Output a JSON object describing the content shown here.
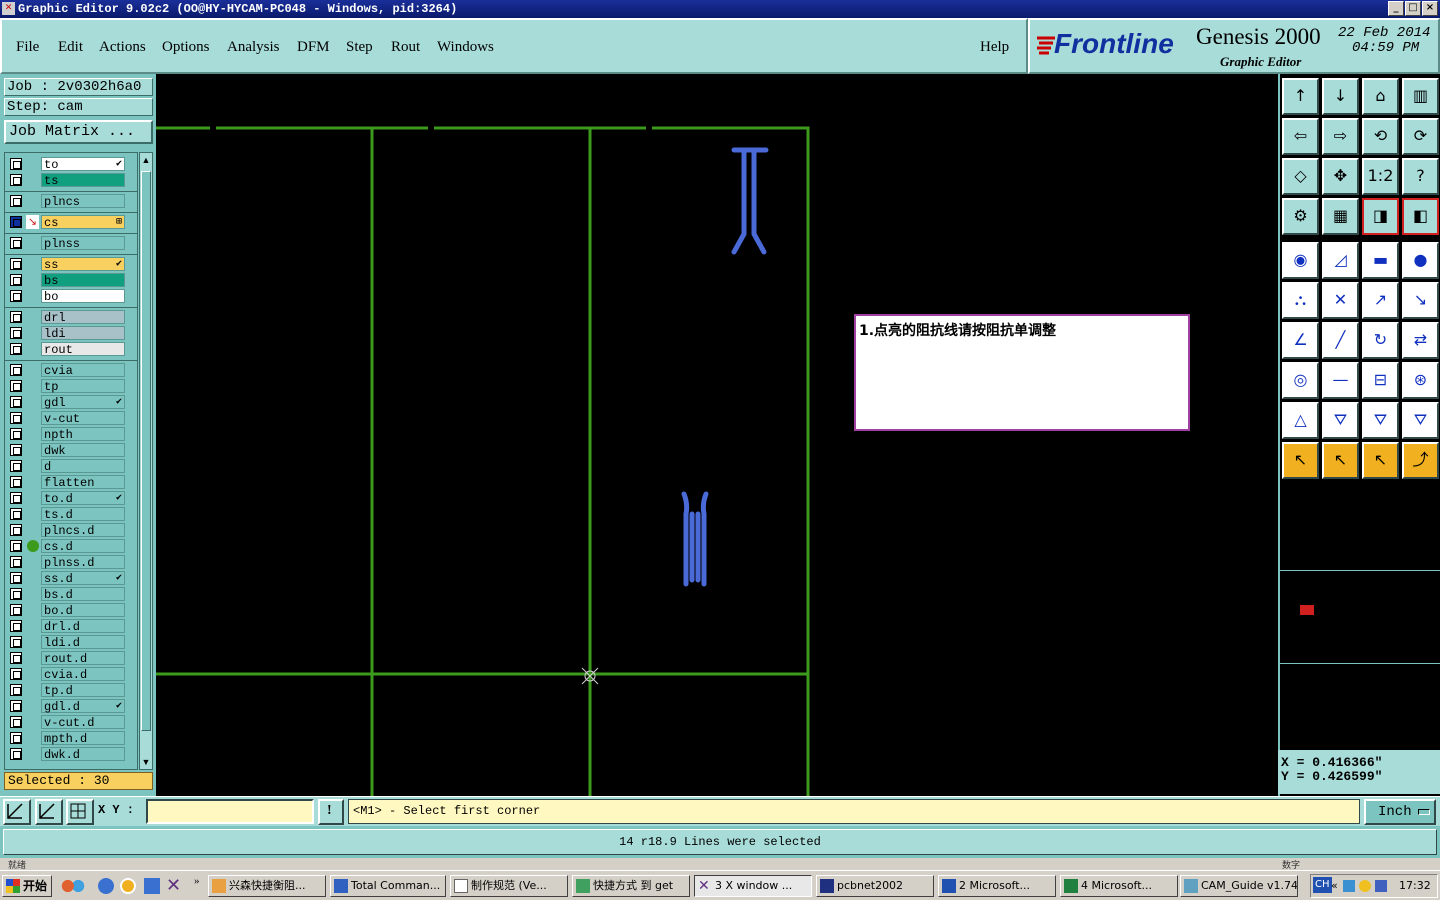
{
  "window": {
    "title": "Graphic Editor 9.02c2 (OO@HY-HYCAM-PC048 - Windows, pid:3264)"
  },
  "menu": {
    "items": [
      "File",
      "Edit",
      "Actions",
      "Options",
      "Analysis",
      "DFM",
      "Step",
      "Rout",
      "Windows"
    ],
    "help": "Help"
  },
  "brand": {
    "logo": "Frontline",
    "product": "Genesis 2000",
    "subtitle": "Graphic Editor",
    "date": "22 Feb 2014",
    "time": "04:59 PM"
  },
  "left": {
    "job": "Job : 2v0302h6a0",
    "step": "Step: cam",
    "job_matrix": "Job Matrix ...",
    "selected": "Selected : 30",
    "layers": [
      {
        "name": "to",
        "color": "#ffffff",
        "mark": "✔"
      },
      {
        "name": "ts",
        "color": "#10a080",
        "mark": ""
      },
      {
        "name": "plncs",
        "color": "#7cc4c0",
        "mark": ""
      },
      {
        "name": "cs",
        "color": "#f8d060",
        "mark": "⊞",
        "active": true
      },
      {
        "name": "plnss",
        "color": "#7cc4c0",
        "mark": ""
      },
      {
        "name": "ss",
        "color": "#f8d060",
        "mark": "✔"
      },
      {
        "name": "bs",
        "color": "#10a080",
        "mark": ""
      },
      {
        "name": "bo",
        "color": "#ffffff",
        "mark": ""
      },
      {
        "name": "drl",
        "color": "#a8c0c8",
        "mark": ""
      },
      {
        "name": "ldi",
        "color": "#a8c0c8",
        "mark": ""
      },
      {
        "name": "rout",
        "color": "#e8e8e8",
        "mark": ""
      },
      {
        "name": "cvia",
        "color": "#7cc4c0",
        "mark": ""
      },
      {
        "name": "tp",
        "color": "#7cc4c0",
        "mark": ""
      },
      {
        "name": "gdl",
        "color": "#7cc4c0",
        "mark": "✔"
      },
      {
        "name": "v-cut",
        "color": "#7cc4c0",
        "mark": ""
      },
      {
        "name": "npth",
        "color": "#7cc4c0",
        "mark": ""
      },
      {
        "name": "dwk",
        "color": "#7cc4c0",
        "mark": ""
      },
      {
        "name": "d",
        "color": "#7cc4c0",
        "mark": ""
      },
      {
        "name": "flatten",
        "color": "#7cc4c0",
        "mark": ""
      },
      {
        "name": "to.d",
        "color": "#7cc4c0",
        "mark": "✔"
      },
      {
        "name": "ts.d",
        "color": "#7cc4c0",
        "mark": ""
      },
      {
        "name": "plncs.d",
        "color": "#7cc4c0",
        "mark": ""
      },
      {
        "name": "cs.d",
        "color": "#7cc4c0",
        "mark": "",
        "dot": true
      },
      {
        "name": "plnss.d",
        "color": "#7cc4c0",
        "mark": ""
      },
      {
        "name": "ss.d",
        "color": "#7cc4c0",
        "mark": "✔"
      },
      {
        "name": "bs.d",
        "color": "#7cc4c0",
        "mark": ""
      },
      {
        "name": "bo.d",
        "color": "#7cc4c0",
        "mark": ""
      },
      {
        "name": "drl.d",
        "color": "#7cc4c0",
        "mark": ""
      },
      {
        "name": "ldi.d",
        "color": "#7cc4c0",
        "mark": ""
      },
      {
        "name": "rout.d",
        "color": "#7cc4c0",
        "mark": ""
      },
      {
        "name": "cvia.d",
        "color": "#7cc4c0",
        "mark": ""
      },
      {
        "name": "tp.d",
        "color": "#7cc4c0",
        "mark": ""
      },
      {
        "name": "gdl.d",
        "color": "#7cc4c0",
        "mark": "✔"
      },
      {
        "name": "v-cut.d",
        "color": "#7cc4c0",
        "mark": ""
      },
      {
        "name": "mpth.d",
        "color": "#7cc4c0",
        "mark": ""
      },
      {
        "name": "dwk.d",
        "color": "#7cc4c0",
        "mark": ""
      }
    ]
  },
  "canvas": {
    "note": "1.点亮的阻抗线请按阻抗单调整"
  },
  "coords": {
    "x": "X = 0.416366\"",
    "y": "Y = 0.426599\""
  },
  "cmd": {
    "xy_label": "X Y :",
    "xy_value": "",
    "prompt": "<M1> - Select first corner",
    "unit": "Inch"
  },
  "status": {
    "message": "14 r18.9 Lines were selected",
    "left": "就绪",
    "right": "数字"
  },
  "taskbar": {
    "start": "开始",
    "tasks": [
      "兴森快捷衡阻...",
      "Total Comman...",
      "制作规范 (Ve...",
      "快捷方式 到 get",
      "3 X window ...",
      "pcbnet2002",
      "2 Microsoft...",
      "4 Microsoft...",
      "CAM_Guide v1.74"
    ],
    "clock": "17:32",
    "lang": "CH"
  },
  "colors": {
    "pcb_green": "#3c9a1c",
    "pcb_gold": "#d09a1a",
    "highlight_blue": "#4a6ad8",
    "panel": "#a8dcd8",
    "panel_dark": "#7cc4c0"
  }
}
